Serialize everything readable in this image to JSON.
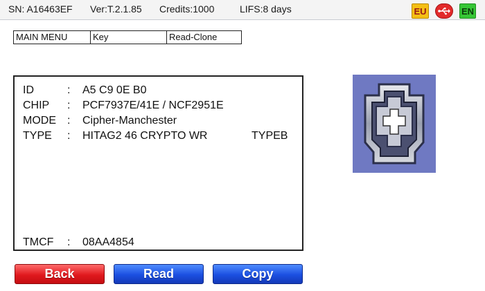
{
  "status": {
    "sn": "SN: A16463EF",
    "version": "Ver:T.2.1.85",
    "credits": "Credits:1000",
    "lifs": "LIFS:8 days",
    "region_badge": "EU",
    "language_badge": "EN",
    "usb_icon": "usb-icon"
  },
  "breadcrumb": [
    "MAIN MENU",
    "Key",
    "Read-Clone"
  ],
  "info": {
    "rows": [
      {
        "label": "ID",
        "colon": ":",
        "value": "A5 C9 0E B0"
      },
      {
        "label": "CHIP",
        "colon": ":",
        "value": "PCF7937E/41E / NCF2951E"
      },
      {
        "label": "MODE",
        "colon": ":",
        "value": "Cipher-Manchester"
      },
      {
        "label": "TYPE",
        "colon": ":",
        "value": "HITAG2 46 CRYPTO WR",
        "extra": "TYPEB"
      }
    ],
    "tmcf": {
      "label": "TMCF",
      "colon": ":",
      "value": "08AA4854"
    }
  },
  "buttons": {
    "back": "Back",
    "read": "Read",
    "copy": "Copy"
  },
  "colors": {
    "back": "#e0191e",
    "read": "#1b4fe0",
    "copy": "#1b4fe0",
    "key_background": "#6f79c2",
    "badge_eu": "#f4bf14",
    "badge_en": "#36c636",
    "badge_usb": "#e22a2a"
  }
}
